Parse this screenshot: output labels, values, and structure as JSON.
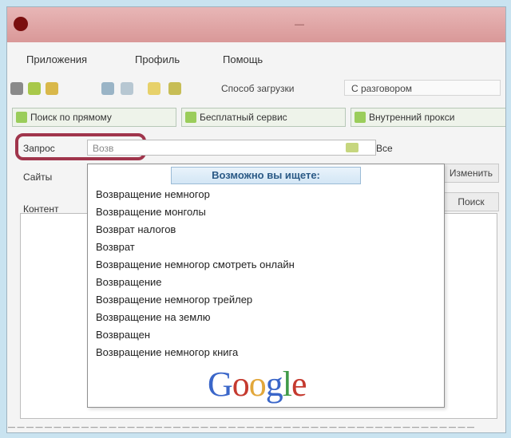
{
  "window": {
    "title": "—"
  },
  "menu": [
    "Приложения",
    "Профиль",
    "Помощь"
  ],
  "toolbar": {
    "mode_label": "Способ загрузки",
    "mode_value": "С разговором"
  },
  "bookmarks": [
    "Поиск по прямому",
    "Бесплатный сервис",
    "Внутренний прокси"
  ],
  "search": {
    "label": "Запрос",
    "value": "Возв",
    "keyword_toggle": "Все"
  },
  "form": {
    "row2_label": "Сайты",
    "row3_label": "Контент",
    "button1": "Изменить",
    "button2": "Поиск"
  },
  "suggest": {
    "header": "Возможно вы ищете:",
    "items": [
      "Возвращение немногор",
      "Возвращение монголы",
      "Возврат налогов",
      "Возврат",
      "Возвращение немногор смотреть онлайн",
      "Возвращение",
      "Возвращение немногор трейлер",
      "Возвращение на землю",
      "Возвращен",
      "Возвращение немногор книга"
    ],
    "brand": "Google"
  },
  "status": "— — — — — — — — — — — — — — — — — — — — — — — — — — — — — — — — — — — — — — — — — — — — — — — — — — —",
  "colors": {
    "accent": "#a0354c",
    "titlebar": "#dca0a0",
    "suggest_header": "#2b5a86"
  },
  "google_colors": [
    "#3a66c9",
    "#c53a2f",
    "#e2a73a",
    "#3a66c9",
    "#3f9a48",
    "#c53a2f"
  ]
}
